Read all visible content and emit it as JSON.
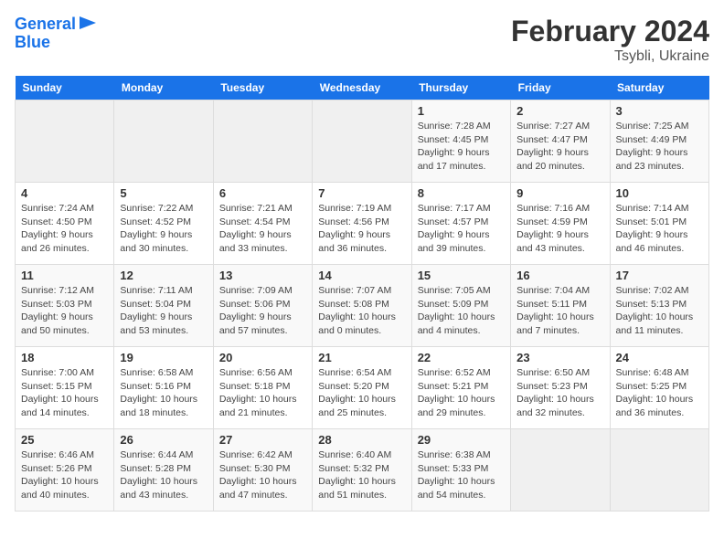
{
  "header": {
    "logo_line1": "General",
    "logo_line2": "Blue",
    "title": "February 2024",
    "subtitle": "Tsybli, Ukraine"
  },
  "weekdays": [
    "Sunday",
    "Monday",
    "Tuesday",
    "Wednesday",
    "Thursday",
    "Friday",
    "Saturday"
  ],
  "weeks": [
    [
      {
        "day": "",
        "info": ""
      },
      {
        "day": "",
        "info": ""
      },
      {
        "day": "",
        "info": ""
      },
      {
        "day": "",
        "info": ""
      },
      {
        "day": "1",
        "info": "Sunrise: 7:28 AM\nSunset: 4:45 PM\nDaylight: 9 hours\nand 17 minutes."
      },
      {
        "day": "2",
        "info": "Sunrise: 7:27 AM\nSunset: 4:47 PM\nDaylight: 9 hours\nand 20 minutes."
      },
      {
        "day": "3",
        "info": "Sunrise: 7:25 AM\nSunset: 4:49 PM\nDaylight: 9 hours\nand 23 minutes."
      }
    ],
    [
      {
        "day": "4",
        "info": "Sunrise: 7:24 AM\nSunset: 4:50 PM\nDaylight: 9 hours\nand 26 minutes."
      },
      {
        "day": "5",
        "info": "Sunrise: 7:22 AM\nSunset: 4:52 PM\nDaylight: 9 hours\nand 30 minutes."
      },
      {
        "day": "6",
        "info": "Sunrise: 7:21 AM\nSunset: 4:54 PM\nDaylight: 9 hours\nand 33 minutes."
      },
      {
        "day": "7",
        "info": "Sunrise: 7:19 AM\nSunset: 4:56 PM\nDaylight: 9 hours\nand 36 minutes."
      },
      {
        "day": "8",
        "info": "Sunrise: 7:17 AM\nSunset: 4:57 PM\nDaylight: 9 hours\nand 39 minutes."
      },
      {
        "day": "9",
        "info": "Sunrise: 7:16 AM\nSunset: 4:59 PM\nDaylight: 9 hours\nand 43 minutes."
      },
      {
        "day": "10",
        "info": "Sunrise: 7:14 AM\nSunset: 5:01 PM\nDaylight: 9 hours\nand 46 minutes."
      }
    ],
    [
      {
        "day": "11",
        "info": "Sunrise: 7:12 AM\nSunset: 5:03 PM\nDaylight: 9 hours\nand 50 minutes."
      },
      {
        "day": "12",
        "info": "Sunrise: 7:11 AM\nSunset: 5:04 PM\nDaylight: 9 hours\nand 53 minutes."
      },
      {
        "day": "13",
        "info": "Sunrise: 7:09 AM\nSunset: 5:06 PM\nDaylight: 9 hours\nand 57 minutes."
      },
      {
        "day": "14",
        "info": "Sunrise: 7:07 AM\nSunset: 5:08 PM\nDaylight: 10 hours\nand 0 minutes."
      },
      {
        "day": "15",
        "info": "Sunrise: 7:05 AM\nSunset: 5:09 PM\nDaylight: 10 hours\nand 4 minutes."
      },
      {
        "day": "16",
        "info": "Sunrise: 7:04 AM\nSunset: 5:11 PM\nDaylight: 10 hours\nand 7 minutes."
      },
      {
        "day": "17",
        "info": "Sunrise: 7:02 AM\nSunset: 5:13 PM\nDaylight: 10 hours\nand 11 minutes."
      }
    ],
    [
      {
        "day": "18",
        "info": "Sunrise: 7:00 AM\nSunset: 5:15 PM\nDaylight: 10 hours\nand 14 minutes."
      },
      {
        "day": "19",
        "info": "Sunrise: 6:58 AM\nSunset: 5:16 PM\nDaylight: 10 hours\nand 18 minutes."
      },
      {
        "day": "20",
        "info": "Sunrise: 6:56 AM\nSunset: 5:18 PM\nDaylight: 10 hours\nand 21 minutes."
      },
      {
        "day": "21",
        "info": "Sunrise: 6:54 AM\nSunset: 5:20 PM\nDaylight: 10 hours\nand 25 minutes."
      },
      {
        "day": "22",
        "info": "Sunrise: 6:52 AM\nSunset: 5:21 PM\nDaylight: 10 hours\nand 29 minutes."
      },
      {
        "day": "23",
        "info": "Sunrise: 6:50 AM\nSunset: 5:23 PM\nDaylight: 10 hours\nand 32 minutes."
      },
      {
        "day": "24",
        "info": "Sunrise: 6:48 AM\nSunset: 5:25 PM\nDaylight: 10 hours\nand 36 minutes."
      }
    ],
    [
      {
        "day": "25",
        "info": "Sunrise: 6:46 AM\nSunset: 5:26 PM\nDaylight: 10 hours\nand 40 minutes."
      },
      {
        "day": "26",
        "info": "Sunrise: 6:44 AM\nSunset: 5:28 PM\nDaylight: 10 hours\nand 43 minutes."
      },
      {
        "day": "27",
        "info": "Sunrise: 6:42 AM\nSunset: 5:30 PM\nDaylight: 10 hours\nand 47 minutes."
      },
      {
        "day": "28",
        "info": "Sunrise: 6:40 AM\nSunset: 5:32 PM\nDaylight: 10 hours\nand 51 minutes."
      },
      {
        "day": "29",
        "info": "Sunrise: 6:38 AM\nSunset: 5:33 PM\nDaylight: 10 hours\nand 54 minutes."
      },
      {
        "day": "",
        "info": ""
      },
      {
        "day": "",
        "info": ""
      }
    ]
  ]
}
